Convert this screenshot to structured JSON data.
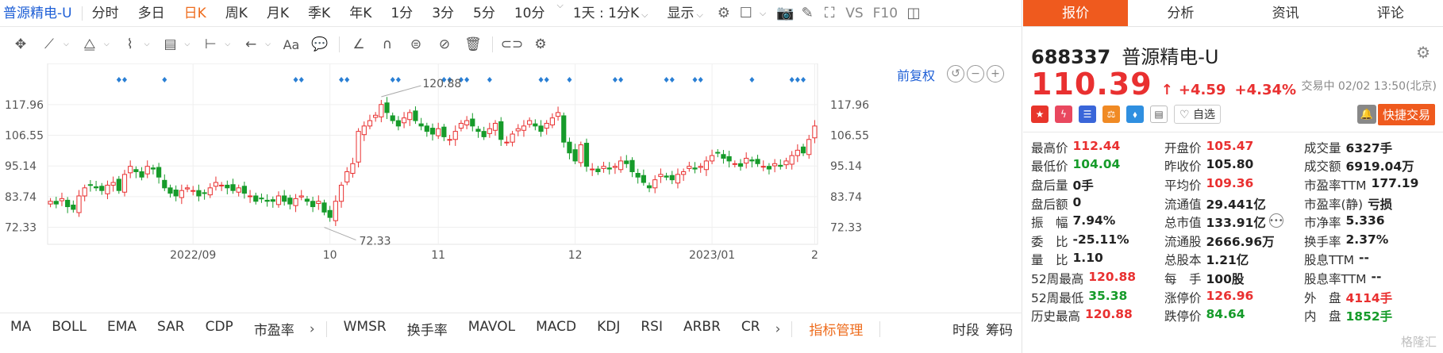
{
  "toolbar": {
    "stock_name": "普源精电-U",
    "periods": [
      "分时",
      "多日",
      "日K",
      "周K",
      "月K",
      "季K",
      "年K",
      "1分",
      "3分",
      "5分",
      "10分"
    ],
    "active_period": "日K",
    "range_select": "1天 : 1分K",
    "display_select": "显示",
    "vs_label": "VS",
    "f10_label": "F10"
  },
  "chart_controls": {
    "adjust_label": "前复权"
  },
  "indicators": {
    "left": [
      "MA",
      "BOLL",
      "EMA",
      "SAR",
      "CDP",
      "市盈率"
    ],
    "right": [
      "WMSR",
      "换手率",
      "MAVOL",
      "MACD",
      "KDJ",
      "RSI",
      "ARBR",
      "CR"
    ],
    "manage": "指标管理",
    "time_label": "时段",
    "chips_label": "筹码"
  },
  "tabs": [
    "报价",
    "分析",
    "资讯",
    "评论"
  ],
  "active_tab": "报价",
  "quote": {
    "code": "688337",
    "name": "普源精电-U",
    "price": "110.39",
    "arrow": "↑",
    "change": "+4.59",
    "change_pct": "+4.34%",
    "status": "交易中 02/02 13:50(北京)",
    "watch_label": "自选",
    "quick_trade": "快捷交易"
  },
  "stats": [
    [
      {
        "label": "最高价",
        "value": "112.44",
        "color": "red"
      },
      {
        "label": "开盘价",
        "value": "105.47",
        "color": "red"
      },
      {
        "label": "成交量",
        "value": "6327手",
        "color": "dark"
      }
    ],
    [
      {
        "label": "最低价",
        "value": "104.04",
        "color": "green"
      },
      {
        "label": "昨收价",
        "value": "105.80",
        "color": "dark"
      },
      {
        "label": "成交额",
        "value": "6919.04万",
        "color": "dark"
      }
    ],
    [
      {
        "label": "盘后量",
        "value": "0手",
        "color": "dark"
      },
      {
        "label": "平均价",
        "value": "109.36",
        "color": "red"
      },
      {
        "label": "市盈率TTM",
        "value": "177.19",
        "color": "dark"
      }
    ],
    [
      {
        "label": "盘后额",
        "value": "0",
        "color": "dark"
      },
      {
        "label": "流通值",
        "value": "29.441亿",
        "color": "dark"
      },
      {
        "label": "市盈率(静)",
        "value": "亏损",
        "color": "dark"
      }
    ],
    [
      {
        "label": "振　幅",
        "value": "7.94%",
        "color": "dark"
      },
      {
        "label": "总市值",
        "value": "133.91亿",
        "color": "dark"
      },
      {
        "label": "市净率",
        "value": "5.336",
        "color": "dark"
      }
    ],
    [
      {
        "label": "委　比",
        "value": "-25.11%",
        "color": "dark"
      },
      {
        "label": "流通股",
        "value": "2666.96万",
        "color": "dark"
      },
      {
        "label": "换手率",
        "value": "2.37%",
        "color": "dark"
      }
    ],
    [
      {
        "label": "量　比",
        "value": "1.10",
        "color": "dark"
      },
      {
        "label": "总股本",
        "value": "1.21亿",
        "color": "dark"
      },
      {
        "label": "股息TTM",
        "value": "--",
        "color": "dark"
      }
    ],
    [
      {
        "label": "52周最高",
        "value": "120.88",
        "color": "red"
      },
      {
        "label": "每　手",
        "value": "100股",
        "color": "dark"
      },
      {
        "label": "股息率TTM",
        "value": "--",
        "color": "dark"
      }
    ],
    [
      {
        "label": "52周最低",
        "value": "35.38",
        "color": "green"
      },
      {
        "label": "涨停价",
        "value": "126.96",
        "color": "red"
      },
      {
        "label": "外　盘",
        "value": "4114手",
        "color": "red"
      }
    ],
    [
      {
        "label": "历史最高",
        "value": "120.88",
        "color": "red"
      },
      {
        "label": "跌停价",
        "value": "84.64",
        "color": "green"
      },
      {
        "label": "内　盘",
        "value": "1852手",
        "color": "green"
      }
    ]
  ],
  "watermark": "格隆汇",
  "colors": {
    "up": "#e93030",
    "down": "#169b2a",
    "accent": "#ef5a1e",
    "link": "#1e5fd6",
    "marker": "#2a7fd4"
  },
  "chart_data": {
    "type": "candlestick",
    "ylim": [
      66,
      125
    ],
    "y_ticks": [
      "117.96",
      "106.55",
      "95.14",
      "83.74",
      "72.33"
    ],
    "y_tick_values": [
      117.96,
      106.55,
      95.14,
      83.74,
      72.33
    ],
    "x_labels": [
      {
        "index": 25,
        "label": "2022/09"
      },
      {
        "index": 49,
        "label": "10"
      },
      {
        "index": 68,
        "label": "11"
      },
      {
        "index": 92,
        "label": "12"
      },
      {
        "index": 116,
        "label": "2023/01"
      },
      {
        "index": 134,
        "label": "2"
      }
    ],
    "max_annotation": {
      "index": 58,
      "value": 120.88,
      "label": "120.88"
    },
    "min_annotation": {
      "index": 48,
      "value": 72.33,
      "label": "72.33"
    },
    "closes": [
      82,
      81,
      83,
      80,
      79,
      84,
      87,
      88,
      87,
      86,
      88,
      89,
      86,
      92,
      95,
      93,
      91,
      95,
      94,
      91,
      87,
      85,
      84,
      86,
      87,
      86,
      84,
      85,
      87,
      89,
      88,
      87,
      86,
      87,
      85,
      84,
      82,
      83,
      82,
      82,
      84,
      82,
      81,
      83,
      84,
      82,
      80,
      82,
      78,
      76,
      82,
      88,
      93,
      96,
      108,
      110,
      112,
      114,
      118,
      115,
      112,
      110,
      113,
      115,
      112,
      110,
      108,
      107,
      109,
      106,
      105,
      108,
      111,
      112,
      110,
      108,
      106,
      109,
      111,
      105,
      104,
      107,
      109,
      110,
      112,
      110,
      108,
      111,
      113,
      115,
      104,
      100,
      97,
      103,
      95,
      94,
      93,
      95,
      94,
      95,
      97,
      96,
      93,
      91,
      89,
      87,
      90,
      92,
      91,
      90,
      92,
      93,
      95,
      94,
      95,
      97,
      99,
      100,
      98,
      97,
      96,
      95,
      98,
      97,
      96,
      95,
      94,
      96,
      95,
      97,
      99,
      101,
      100,
      105,
      110
    ],
    "marker_indices": [
      12,
      13,
      20,
      43,
      44,
      51,
      52,
      60,
      61,
      69,
      70,
      72,
      73,
      77,
      86,
      87,
      91,
      99,
      100,
      108,
      109,
      113,
      114,
      123,
      130,
      131,
      132
    ]
  }
}
